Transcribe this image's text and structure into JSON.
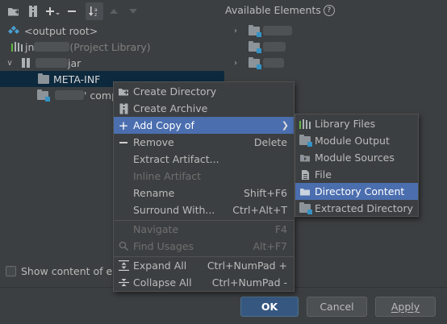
{
  "toolbar": {
    "buttons": [
      {
        "name": "add-folder-icon"
      },
      {
        "name": "archive-icon"
      },
      {
        "name": "add-icon"
      },
      {
        "name": "remove-icon"
      },
      {
        "name": "sort-icon"
      },
      {
        "name": "move-up-icon"
      },
      {
        "name": "move-down-icon"
      }
    ],
    "available_title": "Available Elements",
    "help": "?"
  },
  "left_tree": {
    "output_root": "<output root>",
    "library_row_prefix": "jn",
    "library_row_suffix": "(Project Library)",
    "jar_suffix": "jar",
    "meta_inf": "META-INF",
    "compile_suffix": "' comp"
  },
  "context_menu": {
    "items": [
      {
        "label": "Create Directory",
        "shortcut": "",
        "icon": "folder-icon",
        "disabled": false
      },
      {
        "label": "Create Archive",
        "shortcut": "",
        "icon": "archive-icon",
        "disabled": false
      },
      {
        "label": "Add Copy of",
        "shortcut": "",
        "icon": "plus-icon",
        "disabled": false,
        "highlighted": true,
        "submenu": true
      },
      {
        "label": "Remove",
        "shortcut": "Delete",
        "icon": "minus-icon",
        "disabled": false
      },
      {
        "label": "Extract Artifact...",
        "shortcut": "",
        "icon": "",
        "disabled": false
      },
      {
        "label": "Inline Artifact",
        "shortcut": "",
        "icon": "",
        "disabled": true
      },
      {
        "label": "Rename",
        "shortcut": "Shift+F6",
        "icon": "",
        "disabled": false
      },
      {
        "label": "Surround With...",
        "shortcut": "Ctrl+Alt+T",
        "icon": "",
        "disabled": false
      },
      {
        "label": "Navigate",
        "shortcut": "F4",
        "icon": "",
        "disabled": true
      },
      {
        "label": "Find Usages",
        "shortcut": "Alt+F7",
        "icon": "search-icon",
        "disabled": true
      },
      {
        "label": "Expand All",
        "shortcut": "Ctrl+NumPad +",
        "icon": "expand-all-icon",
        "disabled": false
      },
      {
        "label": "Collapse All",
        "shortcut": "Ctrl+NumPad -",
        "icon": "collapse-all-icon",
        "disabled": false
      }
    ]
  },
  "submenu": {
    "items": [
      {
        "label": "Library Files",
        "icon": "library-icon"
      },
      {
        "label": "Module Output",
        "icon": "module-output-icon"
      },
      {
        "label": "Module Sources",
        "icon": "module-sources-icon"
      },
      {
        "label": "File",
        "icon": "file-icon"
      },
      {
        "label": "Directory Content",
        "icon": "directory-content-icon",
        "highlighted": true
      },
      {
        "label": "Extracted Directory",
        "icon": "extracted-directory-icon"
      }
    ]
  },
  "footer": {
    "show_content_label": "Show content of ele",
    "ok": "OK",
    "cancel": "Cancel",
    "apply": "Apply"
  },
  "colors": {
    "background": "#3c3f41",
    "selection": "#4b6eaf",
    "tree_selection": "#0d293e",
    "ok_button": "#365880"
  }
}
